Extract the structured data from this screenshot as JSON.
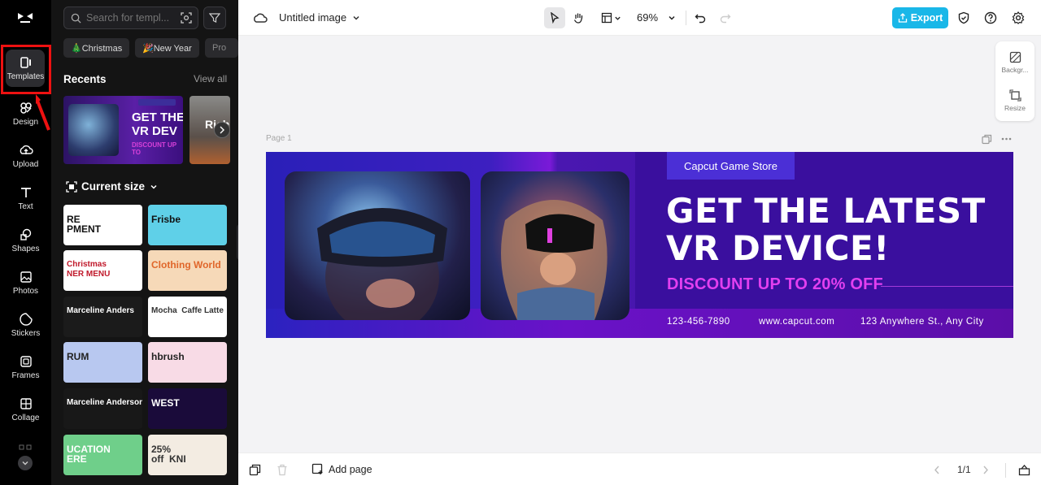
{
  "app": {
    "title": "Untitled image",
    "zoom": "69%",
    "export_label": "Export"
  },
  "rail": {
    "items": [
      {
        "label": "Templates",
        "icon": "templates-icon",
        "active": true
      },
      {
        "label": "Design",
        "icon": "design-icon"
      },
      {
        "label": "Upload",
        "icon": "upload-icon"
      },
      {
        "label": "Text",
        "icon": "text-icon"
      },
      {
        "label": "Shapes",
        "icon": "shapes-icon"
      },
      {
        "label": "Photos",
        "icon": "photos-icon"
      },
      {
        "label": "Stickers",
        "icon": "stickers-icon"
      },
      {
        "label": "Frames",
        "icon": "frames-icon"
      },
      {
        "label": "Collage",
        "icon": "collage-icon"
      }
    ]
  },
  "panel": {
    "search_placeholder": "Search for templ...",
    "chips": [
      "🎄Christmas",
      "🎉New Year",
      "Pro"
    ],
    "recents_title": "Recents",
    "view_all": "View all",
    "recent_main_text": "GET THE\nVR DEV",
    "recent_main_discount": "DISCOUNT UP TO",
    "recent_2_text": "Rich",
    "current_size_label": "Current size",
    "thumbs": [
      {
        "text": "RE\nPMENT",
        "bg": "#ffffff",
        "fg": "#111"
      },
      {
        "text": "Frisbe",
        "bg": "#5fd0e8",
        "fg": "#111"
      },
      {
        "text": "Christmas\nNER MENU",
        "bg": "#ffffff",
        "fg": "#c0182a"
      },
      {
        "text": "Clothing World",
        "bg": "#f6d9b8",
        "fg": "#e0662a"
      },
      {
        "text": "Marceline Anders",
        "bg": "#1b1b1b",
        "fg": "#fff"
      },
      {
        "text": "Mocha  Caffe Latte",
        "bg": "#ffffff",
        "fg": "#333"
      },
      {
        "text": "RUM",
        "bg": "#b8c8f0",
        "fg": "#222"
      },
      {
        "text": "hbrush",
        "bg": "#f8dbe6",
        "fg": "#222"
      },
      {
        "text": "Marceline Anderson",
        "bg": "#181818",
        "fg": "#fff"
      },
      {
        "text": "WEST",
        "bg": "#1a0b3a",
        "fg": "#fff"
      },
      {
        "text": "UCATION\nERE",
        "bg": "#6fcf8a",
        "fg": "#fff"
      },
      {
        "text": "25%\noff  KNI",
        "bg": "#f3ece2",
        "fg": "#333"
      }
    ]
  },
  "canvas": {
    "page_label": "Page 1",
    "side_tools": [
      "Backgr...",
      "Resize"
    ],
    "banner": {
      "store_tag": "Capcut Game Store",
      "headline": "GET THE LATEST\nVR DEVICE!",
      "discount": "DISCOUNT UP TO 20% OFF",
      "phone": "123-456-7890",
      "website": "www.capcut.com",
      "address": "123 Anywhere St., Any City"
    }
  },
  "bottom": {
    "add_page": "Add page",
    "page_counter": "1/1"
  },
  "colors": {
    "accent": "#19b7e8",
    "highlight": "#ee1111",
    "banner_purple": "#3a0f9e",
    "discount_magenta": "#e23ff0"
  }
}
